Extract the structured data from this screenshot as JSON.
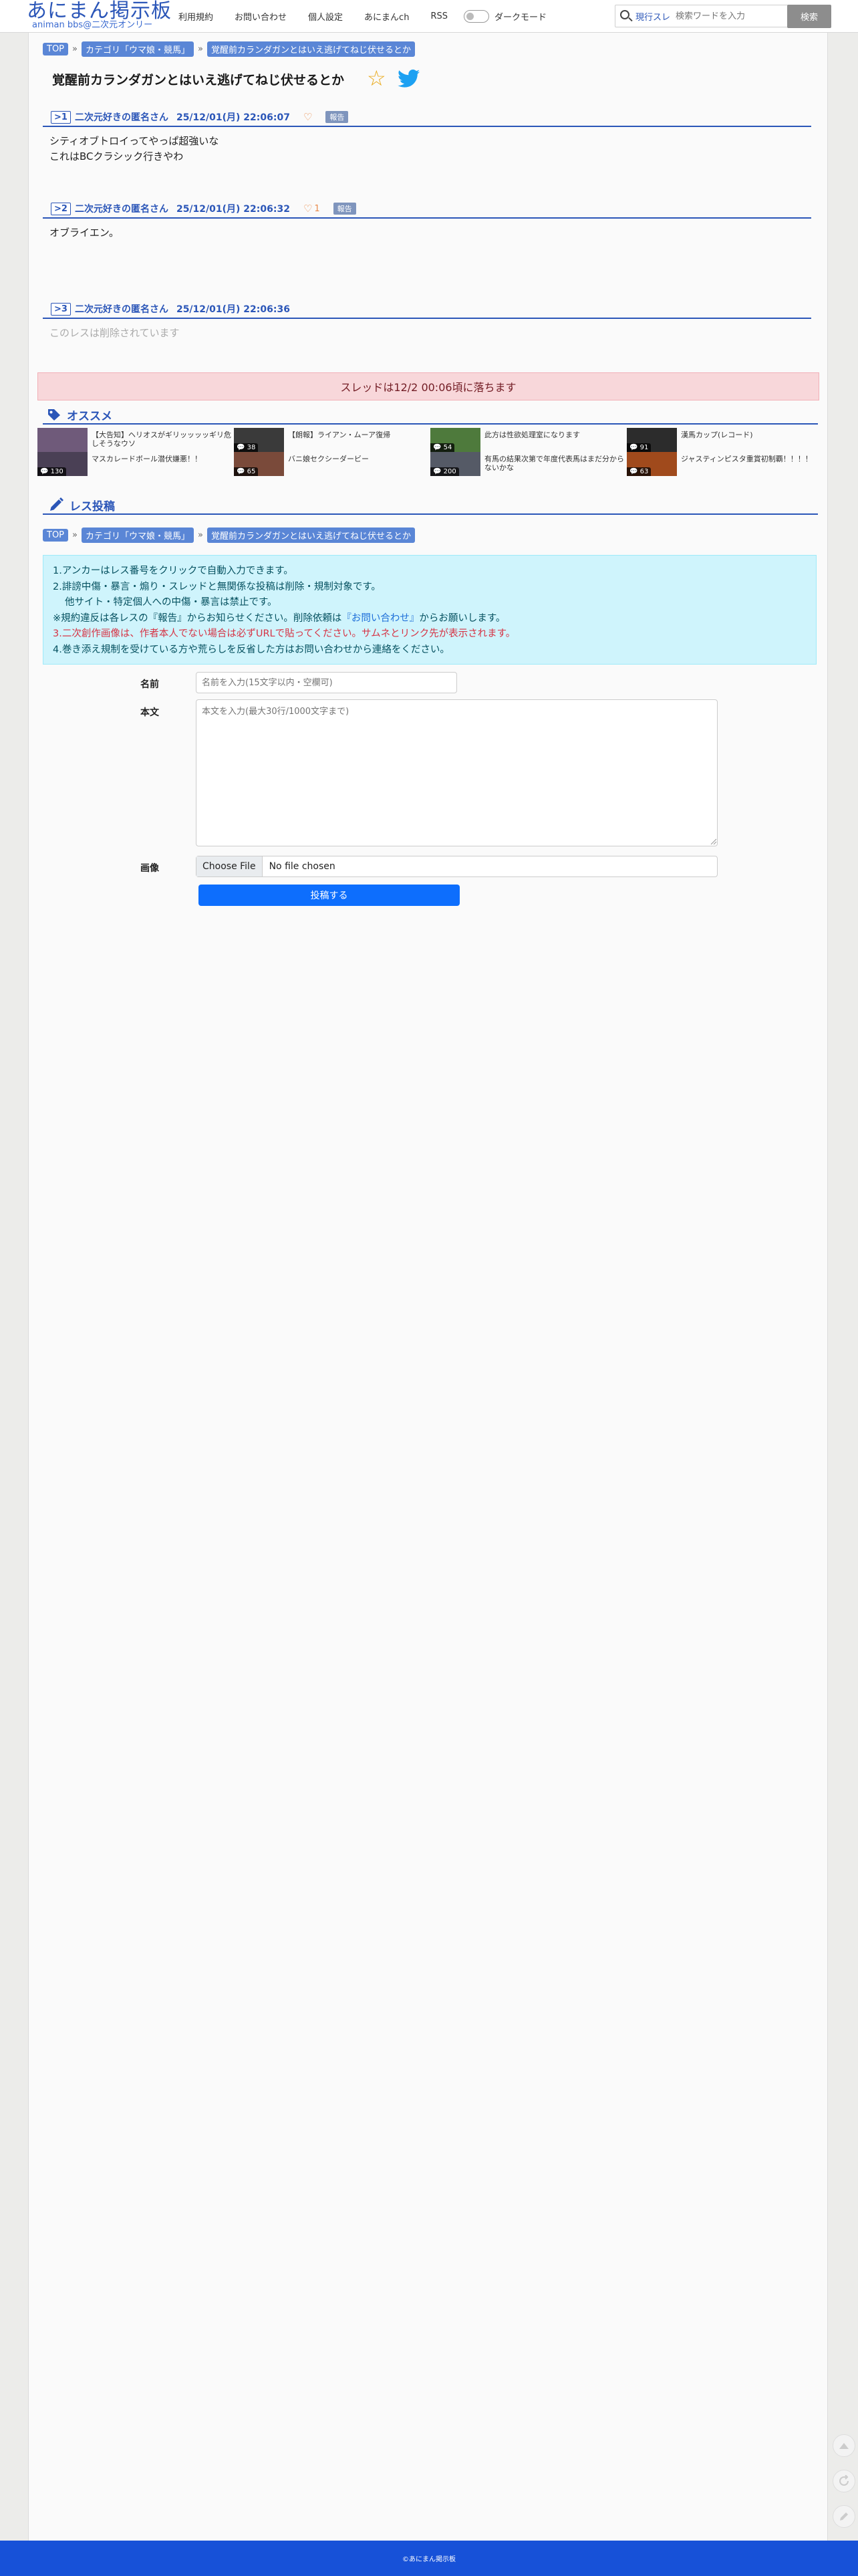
{
  "header": {
    "logo_main": "あにまん掲示板",
    "logo_sub": "animan bbs@二次元オンリー",
    "nav": [
      "利用規約",
      "お問い合わせ",
      "個人設定",
      "あにまんch",
      "RSS"
    ],
    "dark_mode_label": "ダークモード",
    "search_scope": "現行スレ",
    "search_placeholder": "検索ワードを入力",
    "search_button": "検索"
  },
  "breadcrumb": [
    "TOP",
    "カテゴリ「ウマ娘・競馬」",
    "覚醒前カランダガンとはいえ逃げてねじ伏せるとか"
  ],
  "thread": {
    "title": "覚醒前カランダガンとはいえ逃げてねじ伏せるとか"
  },
  "responses": [
    {
      "num": ">1",
      "name": "二次元好きの匿名さん",
      "date": "25/12/01(月) 22:06:07",
      "likes": "",
      "report": "報告",
      "lines": [
        "シティオブトロイってやっぱ超強いな",
        "これはBCクラシック行きやわ"
      ]
    },
    {
      "num": ">2",
      "name": "二次元好きの匿名さん",
      "date": "25/12/01(月) 22:06:32",
      "likes": "1",
      "report": "報告",
      "lines": [
        "オブライエン。"
      ]
    },
    {
      "num": ">3",
      "name": "二次元好きの匿名さん",
      "date": "25/12/01(月) 22:06:36",
      "deleted_text": "このレスは削除されています"
    }
  ],
  "notice": "スレッドは12/2 00:06頃に落ちます",
  "recommend": {
    "title": "オススメ",
    "items": [
      {
        "title": "【大告知】ヘリオスがギリッッッッギリ危しそうなウソ",
        "count": "",
        "color": "#6f5a7a"
      },
      {
        "title": "【朗報】ライアン・ムーア復帰",
        "count": "38",
        "color": "#3a3a3a"
      },
      {
        "title": "此方は性欲処理室になります",
        "count": "54",
        "color": "#4e7a3c"
      },
      {
        "title": "漢馬カップ(レコード)",
        "count": "91",
        "color": "#2c2c2c"
      },
      {
        "title": "マスカレードボール潜伏嫌悪！！",
        "count": "130",
        "color": "#4a4055"
      },
      {
        "title": "バニ娘セクシーダービー",
        "count": "65",
        "color": "#7a4a3a"
      },
      {
        "title": "有馬の結果次第で年度代表馬はまだ分からないかな",
        "count": "200",
        "color": "#555a66"
      },
      {
        "title": "ジャスティンピスタ重賞初制覇！！！！",
        "count": "63",
        "color": "#a04a1c"
      }
    ]
  },
  "post_form": {
    "title": "レス投稿",
    "rules": [
      "1.アンカーはレス番号をクリックで自動入力できます。",
      "2.誹謗中傷・暴言・煽り・スレッドと無関係な投稿は削除・規制対象です。",
      "他サイト・特定個人への中傷・暴言は禁止です。",
      "※規約違反は各レスの『報告』からお知らせください。削除依頼は",
      "『お問い合わせ』",
      "からお願いします。",
      "3.二次創作画像は、作者本人でない場合は必ずURLで貼ってください。サムネとリンク先が表示されます。",
      "4.巻き添え規制を受けている方や荒らしを反省した方はお問い合わせから連絡をください。"
    ],
    "name_label": "名前",
    "name_placeholder": "名前を入力(15文字以内・空欄可)",
    "body_label": "本文",
    "body_placeholder": "本文を入力(最大30行/1000文字まで)",
    "image_label": "画像",
    "file_button": "Choose File",
    "file_status": "No file chosen",
    "submit": "投稿する"
  },
  "footer": "©あにまん掲示板",
  "colors": {
    "brand": "#2b56b8",
    "footer": "#1751d8",
    "notice_bg": "#f8d7da",
    "info_bg": "#cff4fc",
    "submit": "#0d6efd"
  }
}
